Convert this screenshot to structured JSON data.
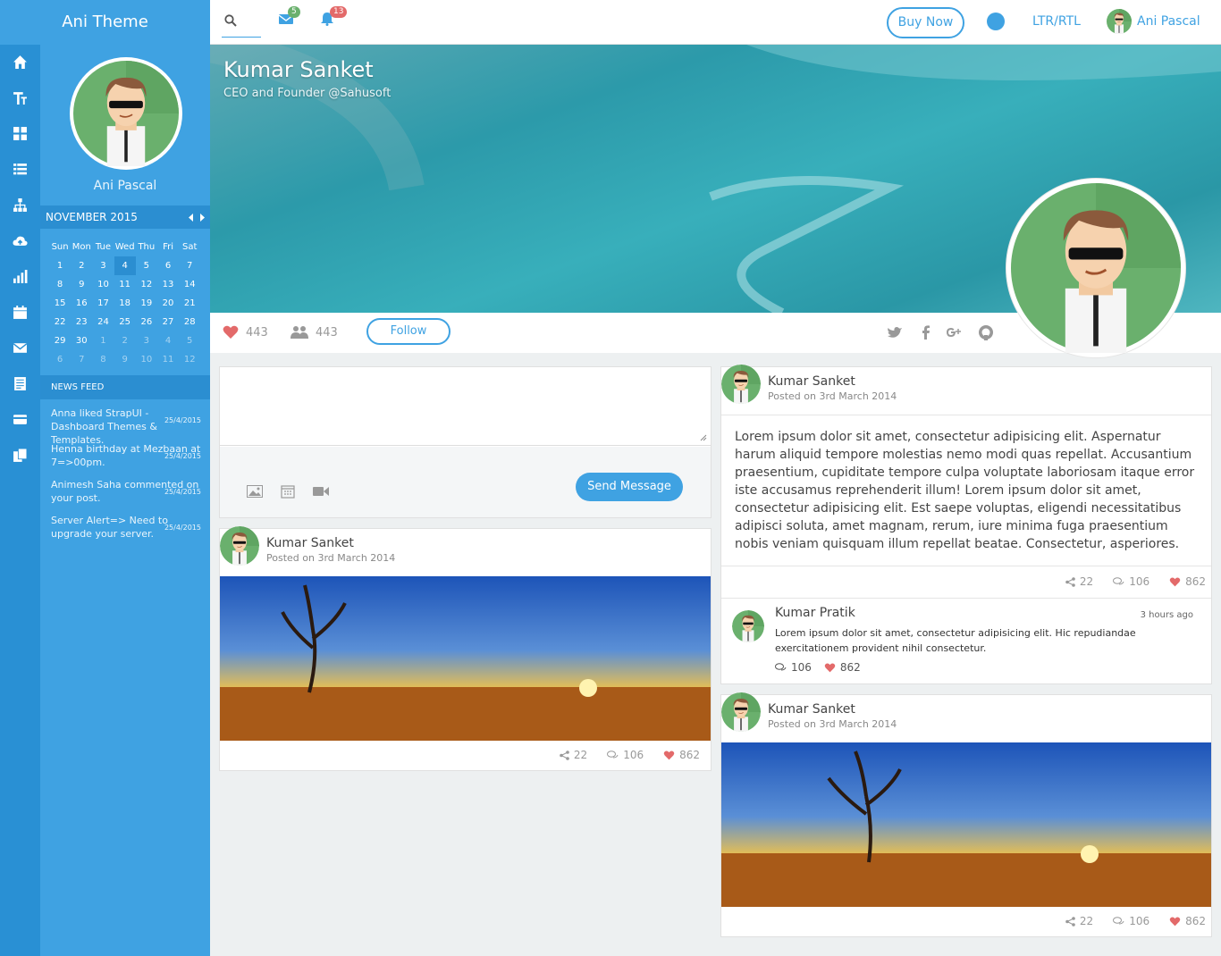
{
  "brand": "Ani Theme",
  "topbar": {
    "mail_count": "5",
    "notif_count": "13",
    "buy_now": "Buy Now",
    "ltr_rtl": "LTR/RTL",
    "user_name": "Ani Pascal"
  },
  "side": {
    "profile_name": "Ani Pascal",
    "calendar": {
      "month": "NOVEMBER 2015",
      "days": [
        "Sun",
        "Mon",
        "Tue",
        "Wed",
        "Thu",
        "Fri",
        "Sat"
      ],
      "weeks": [
        [
          "1",
          "2",
          "3",
          "4",
          "5",
          "6",
          "7"
        ],
        [
          "8",
          "9",
          "10",
          "11",
          "12",
          "13",
          "14"
        ],
        [
          "15",
          "16",
          "17",
          "18",
          "19",
          "20",
          "21"
        ],
        [
          "22",
          "23",
          "24",
          "25",
          "26",
          "27",
          "28"
        ],
        [
          "29",
          "30",
          "1",
          "2",
          "3",
          "4",
          "5"
        ],
        [
          "6",
          "7",
          "8",
          "9",
          "10",
          "11",
          "12"
        ]
      ]
    },
    "news_feed_title": "NEWS FEED",
    "news": [
      {
        "text": "Anna liked StrapUI - Dashboard Themes & Templates.",
        "date": "25/4/2015"
      },
      {
        "text": "Henna birthday at Mezbaan at 7=>00pm.",
        "date": "25/4/2015"
      },
      {
        "text": "Animesh Saha commented on your post.",
        "date": "25/4/2015"
      },
      {
        "text": "Server Alert=> Need to upgrade your server.",
        "date": "25/4/2015"
      }
    ]
  },
  "cover": {
    "name": "Kumar Sanket",
    "title": "CEO and Founder @Sahusoft",
    "likes": "443",
    "friends": "443",
    "follow": "Follow"
  },
  "compose": {
    "send": "Send Message"
  },
  "post1": {
    "author": "Kumar Sanket",
    "date": "Posted on 3rd March 2014",
    "shares": "22",
    "comments": "106",
    "likes": "862"
  },
  "post2": {
    "author": "Kumar Sanket",
    "date": "Posted on 3rd March 2014",
    "body": "Lorem ipsum dolor sit amet, consectetur adipisicing elit. Aspernatur harum aliquid tempore molestias nemo modi quas repellat. Accusantium praesentium, cupiditate tempore culpa voluptate laboriosam itaque error iste accusamus reprehenderit illum! Lorem ipsum dolor sit amet, consectetur adipisicing elit. Est saepe voluptas, eligendi necessitatibus adipisci soluta, amet magnam, rerum, iure minima fuga praesentium nobis veniam quisquam illum repellat beatae. Consectetur, asperiores.",
    "shares": "22",
    "comments": "106",
    "likes": "862",
    "comment": {
      "author": "Kumar Pratik",
      "time": "3 hours ago",
      "text": "Lorem ipsum dolor sit amet, consectetur adipisicing elit. Hic repudiandae exercitationem provident nihil consectetur.",
      "comments": "106",
      "likes": "862"
    }
  },
  "post3": {
    "author": "Kumar Sanket",
    "date": "Posted on 3rd March 2014",
    "shares": "22",
    "comments": "106",
    "likes": "862"
  },
  "icons": {
    "rail": [
      "home-icon",
      "text-icon",
      "grid-icon",
      "list-icon",
      "sitemap-icon",
      "cloud-upload-icon",
      "bar-chart-icon",
      "calendar-icon",
      "mail-icon",
      "document-icon",
      "card-icon",
      "files-icon"
    ],
    "accent": "#3fa2e2"
  }
}
